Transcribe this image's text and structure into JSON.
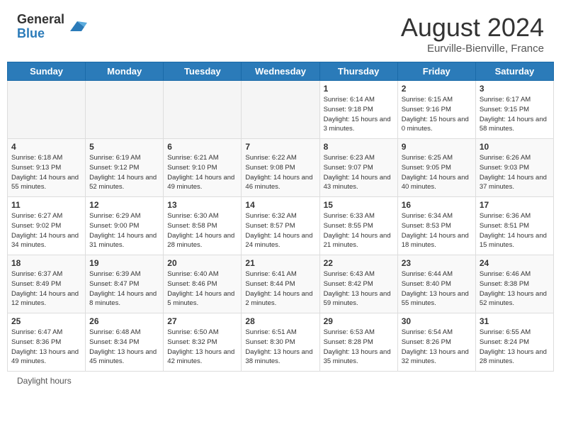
{
  "header": {
    "logo_general": "General",
    "logo_blue": "Blue",
    "month_year": "August 2024",
    "location": "Eurville-Bienville, France"
  },
  "days_of_week": [
    "Sunday",
    "Monday",
    "Tuesday",
    "Wednesday",
    "Thursday",
    "Friday",
    "Saturday"
  ],
  "weeks": [
    [
      {
        "num": "",
        "sunrise": "",
        "sunset": "",
        "daylight": "",
        "empty": true
      },
      {
        "num": "",
        "sunrise": "",
        "sunset": "",
        "daylight": "",
        "empty": true
      },
      {
        "num": "",
        "sunrise": "",
        "sunset": "",
        "daylight": "",
        "empty": true
      },
      {
        "num": "",
        "sunrise": "",
        "sunset": "",
        "daylight": "",
        "empty": true
      },
      {
        "num": "1",
        "sunrise": "Sunrise: 6:14 AM",
        "sunset": "Sunset: 9:18 PM",
        "daylight": "Daylight: 15 hours and 3 minutes.",
        "empty": false
      },
      {
        "num": "2",
        "sunrise": "Sunrise: 6:15 AM",
        "sunset": "Sunset: 9:16 PM",
        "daylight": "Daylight: 15 hours and 0 minutes.",
        "empty": false
      },
      {
        "num": "3",
        "sunrise": "Sunrise: 6:17 AM",
        "sunset": "Sunset: 9:15 PM",
        "daylight": "Daylight: 14 hours and 58 minutes.",
        "empty": false
      }
    ],
    [
      {
        "num": "4",
        "sunrise": "Sunrise: 6:18 AM",
        "sunset": "Sunset: 9:13 PM",
        "daylight": "Daylight: 14 hours and 55 minutes.",
        "empty": false
      },
      {
        "num": "5",
        "sunrise": "Sunrise: 6:19 AM",
        "sunset": "Sunset: 9:12 PM",
        "daylight": "Daylight: 14 hours and 52 minutes.",
        "empty": false
      },
      {
        "num": "6",
        "sunrise": "Sunrise: 6:21 AM",
        "sunset": "Sunset: 9:10 PM",
        "daylight": "Daylight: 14 hours and 49 minutes.",
        "empty": false
      },
      {
        "num": "7",
        "sunrise": "Sunrise: 6:22 AM",
        "sunset": "Sunset: 9:08 PM",
        "daylight": "Daylight: 14 hours and 46 minutes.",
        "empty": false
      },
      {
        "num": "8",
        "sunrise": "Sunrise: 6:23 AM",
        "sunset": "Sunset: 9:07 PM",
        "daylight": "Daylight: 14 hours and 43 minutes.",
        "empty": false
      },
      {
        "num": "9",
        "sunrise": "Sunrise: 6:25 AM",
        "sunset": "Sunset: 9:05 PM",
        "daylight": "Daylight: 14 hours and 40 minutes.",
        "empty": false
      },
      {
        "num": "10",
        "sunrise": "Sunrise: 6:26 AM",
        "sunset": "Sunset: 9:03 PM",
        "daylight": "Daylight: 14 hours and 37 minutes.",
        "empty": false
      }
    ],
    [
      {
        "num": "11",
        "sunrise": "Sunrise: 6:27 AM",
        "sunset": "Sunset: 9:02 PM",
        "daylight": "Daylight: 14 hours and 34 minutes.",
        "empty": false
      },
      {
        "num": "12",
        "sunrise": "Sunrise: 6:29 AM",
        "sunset": "Sunset: 9:00 PM",
        "daylight": "Daylight: 14 hours and 31 minutes.",
        "empty": false
      },
      {
        "num": "13",
        "sunrise": "Sunrise: 6:30 AM",
        "sunset": "Sunset: 8:58 PM",
        "daylight": "Daylight: 14 hours and 28 minutes.",
        "empty": false
      },
      {
        "num": "14",
        "sunrise": "Sunrise: 6:32 AM",
        "sunset": "Sunset: 8:57 PM",
        "daylight": "Daylight: 14 hours and 24 minutes.",
        "empty": false
      },
      {
        "num": "15",
        "sunrise": "Sunrise: 6:33 AM",
        "sunset": "Sunset: 8:55 PM",
        "daylight": "Daylight: 14 hours and 21 minutes.",
        "empty": false
      },
      {
        "num": "16",
        "sunrise": "Sunrise: 6:34 AM",
        "sunset": "Sunset: 8:53 PM",
        "daylight": "Daylight: 14 hours and 18 minutes.",
        "empty": false
      },
      {
        "num": "17",
        "sunrise": "Sunrise: 6:36 AM",
        "sunset": "Sunset: 8:51 PM",
        "daylight": "Daylight: 14 hours and 15 minutes.",
        "empty": false
      }
    ],
    [
      {
        "num": "18",
        "sunrise": "Sunrise: 6:37 AM",
        "sunset": "Sunset: 8:49 PM",
        "daylight": "Daylight: 14 hours and 12 minutes.",
        "empty": false
      },
      {
        "num": "19",
        "sunrise": "Sunrise: 6:39 AM",
        "sunset": "Sunset: 8:47 PM",
        "daylight": "Daylight: 14 hours and 8 minutes.",
        "empty": false
      },
      {
        "num": "20",
        "sunrise": "Sunrise: 6:40 AM",
        "sunset": "Sunset: 8:46 PM",
        "daylight": "Daylight: 14 hours and 5 minutes.",
        "empty": false
      },
      {
        "num": "21",
        "sunrise": "Sunrise: 6:41 AM",
        "sunset": "Sunset: 8:44 PM",
        "daylight": "Daylight: 14 hours and 2 minutes.",
        "empty": false
      },
      {
        "num": "22",
        "sunrise": "Sunrise: 6:43 AM",
        "sunset": "Sunset: 8:42 PM",
        "daylight": "Daylight: 13 hours and 59 minutes.",
        "empty": false
      },
      {
        "num": "23",
        "sunrise": "Sunrise: 6:44 AM",
        "sunset": "Sunset: 8:40 PM",
        "daylight": "Daylight: 13 hours and 55 minutes.",
        "empty": false
      },
      {
        "num": "24",
        "sunrise": "Sunrise: 6:46 AM",
        "sunset": "Sunset: 8:38 PM",
        "daylight": "Daylight: 13 hours and 52 minutes.",
        "empty": false
      }
    ],
    [
      {
        "num": "25",
        "sunrise": "Sunrise: 6:47 AM",
        "sunset": "Sunset: 8:36 PM",
        "daylight": "Daylight: 13 hours and 49 minutes.",
        "empty": false
      },
      {
        "num": "26",
        "sunrise": "Sunrise: 6:48 AM",
        "sunset": "Sunset: 8:34 PM",
        "daylight": "Daylight: 13 hours and 45 minutes.",
        "empty": false
      },
      {
        "num": "27",
        "sunrise": "Sunrise: 6:50 AM",
        "sunset": "Sunset: 8:32 PM",
        "daylight": "Daylight: 13 hours and 42 minutes.",
        "empty": false
      },
      {
        "num": "28",
        "sunrise": "Sunrise: 6:51 AM",
        "sunset": "Sunset: 8:30 PM",
        "daylight": "Daylight: 13 hours and 38 minutes.",
        "empty": false
      },
      {
        "num": "29",
        "sunrise": "Sunrise: 6:53 AM",
        "sunset": "Sunset: 8:28 PM",
        "daylight": "Daylight: 13 hours and 35 minutes.",
        "empty": false
      },
      {
        "num": "30",
        "sunrise": "Sunrise: 6:54 AM",
        "sunset": "Sunset: 8:26 PM",
        "daylight": "Daylight: 13 hours and 32 minutes.",
        "empty": false
      },
      {
        "num": "31",
        "sunrise": "Sunrise: 6:55 AM",
        "sunset": "Sunset: 8:24 PM",
        "daylight": "Daylight: 13 hours and 28 minutes.",
        "empty": false
      }
    ]
  ],
  "footer": {
    "daylight_label": "Daylight hours"
  }
}
